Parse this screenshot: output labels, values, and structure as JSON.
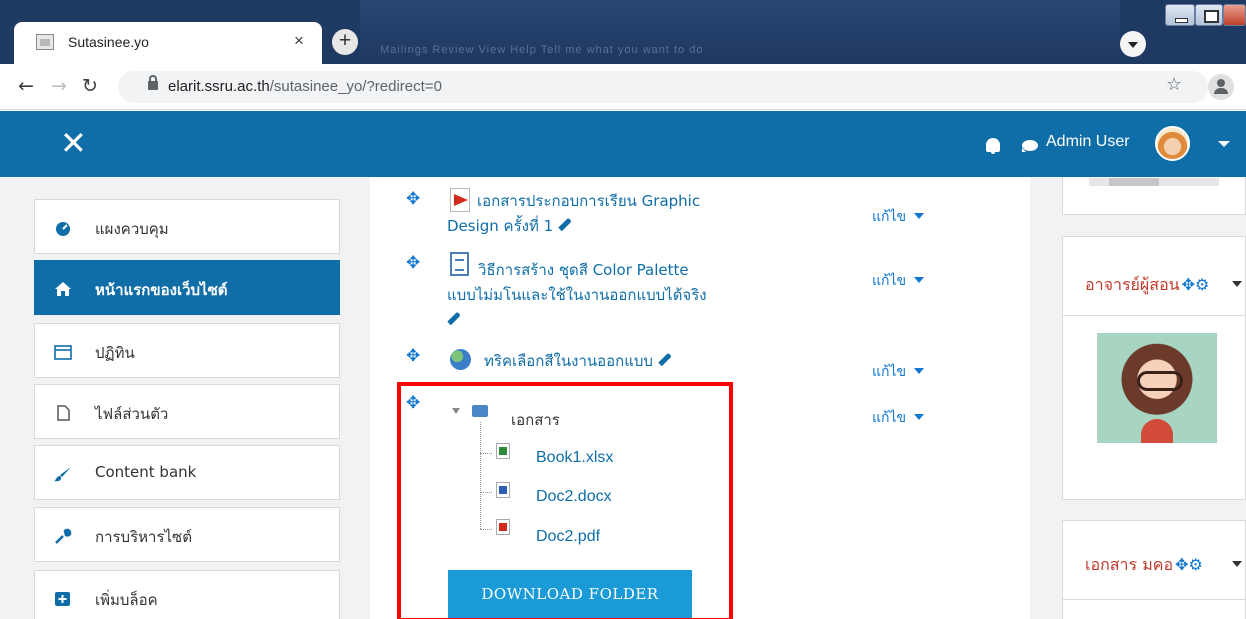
{
  "browser": {
    "tab_title": "Sutasinee.yo",
    "tab_close": "×",
    "new_tab": "+",
    "url_host": "elarit.ssru.ac.th",
    "url_path": "/sutasinee_yo/?redirect=0",
    "background_text": "Mailings   Review   View   Help   Tell me what you want to do"
  },
  "navbar": {
    "close_symbol": "✕",
    "user_name": "Admin User",
    "bg_color": "#0f6ea8"
  },
  "drawer": {
    "items": [
      {
        "label": "แผงควบคุม",
        "icon": "dashboard-icon"
      },
      {
        "label": "หน้าแรกของเว็บไซต์",
        "icon": "home-icon",
        "active": true
      },
      {
        "label": "ปฏิทิน",
        "icon": "calendar-icon"
      },
      {
        "label": "ไฟล์ส่วนตัว",
        "icon": "file-icon"
      },
      {
        "label": "Content bank",
        "icon": "paint-brush-icon"
      },
      {
        "label": "การบริหารไซต์",
        "icon": "wrench-icon"
      },
      {
        "label": "เพิ่มบล็อค",
        "icon": "plus-square-icon"
      }
    ]
  },
  "activities": [
    {
      "title_line1": "เอกสารประกอบการเรียน Graphic",
      "title_line2": "Design ครั้งที่ 1",
      "icon": "pdf-icon",
      "edit": "แก้ไข"
    },
    {
      "title_line1": "วิธีการสร้าง ชุดสี Color Palette",
      "title_line2": "แบบไม่มโนและใช้ในงานออกแบบได้จริง",
      "icon": "page-icon",
      "edit": "แก้ไข"
    },
    {
      "title_line1": "ทริคเลือกสีในงานออกแบบ",
      "icon": "url-globe-icon",
      "edit": "แก้ไข"
    }
  ],
  "folder": {
    "name": "เอกสาร",
    "edit": "แก้ไข",
    "files": [
      {
        "name": "Book1.xlsx",
        "type": "xlsx"
      },
      {
        "name": "Doc2.docx",
        "type": "docx"
      },
      {
        "name": "Doc2.pdf",
        "type": "pdf"
      }
    ],
    "download_label": "DOWNLOAD FOLDER"
  },
  "blocks": {
    "teacher_title": "อาจารย์ผู้สอน",
    "docs_title": "เอกสาร มคอ"
  },
  "colors": {
    "highlight": "#ff0000",
    "link": "#0f6ea8",
    "button": "#1a9bd7"
  }
}
